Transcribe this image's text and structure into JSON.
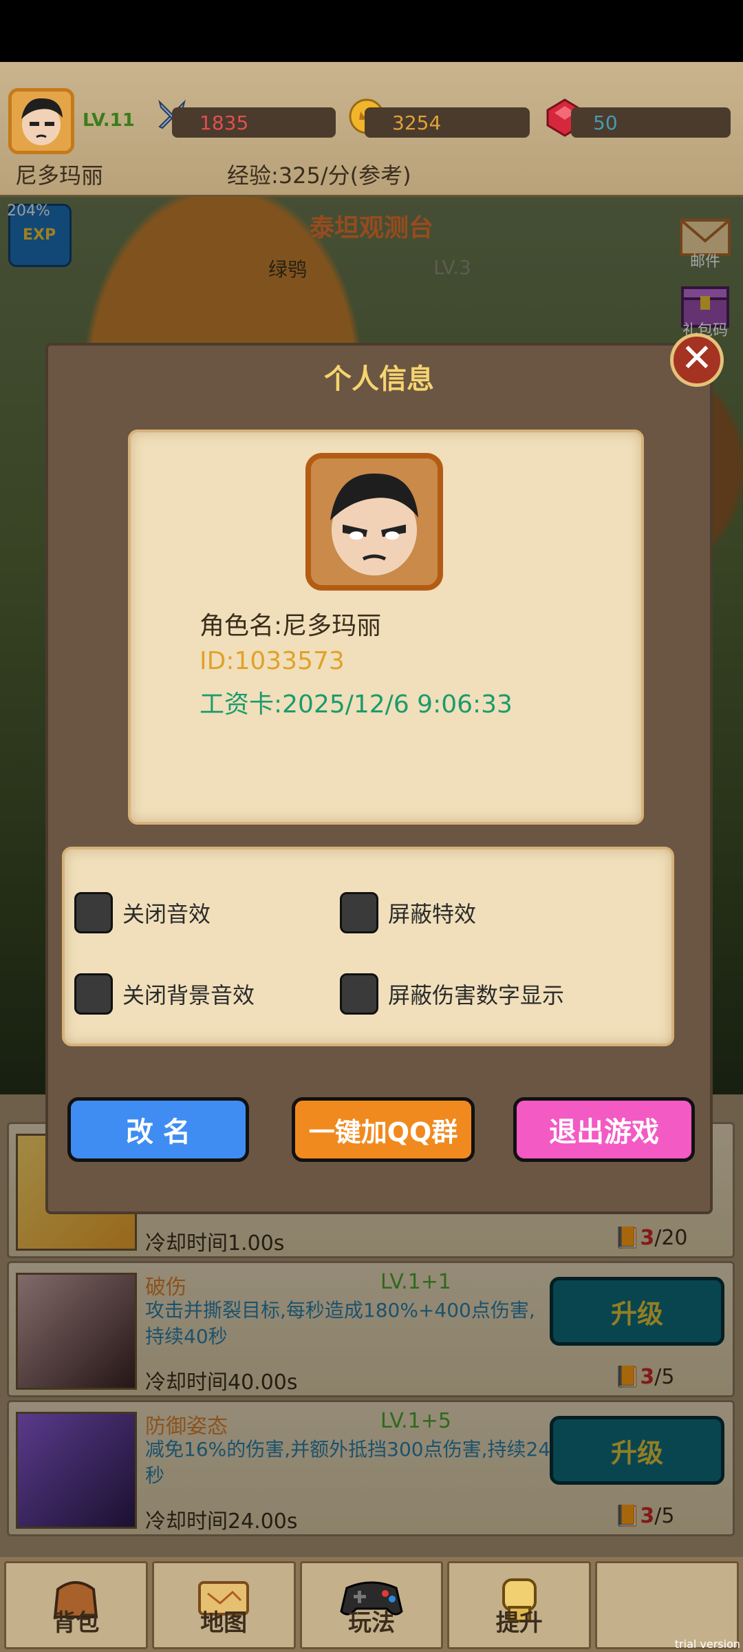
{
  "header": {
    "level": "LV.11",
    "power": "1835",
    "coins": "3254",
    "gems": "50",
    "username": "尼多玛丽",
    "exp_rate": "经验:325/分(参考)"
  },
  "scene": {
    "title": "泰坦观测台",
    "subtitle": "绿鸮",
    "level": "LV.3",
    "boost_percent": "204%",
    "boost_label": "EXP",
    "side_buttons": [
      "邮件",
      "礼包码"
    ]
  },
  "dialog": {
    "title": "个人信息",
    "close": "✕",
    "name_line": "角色名:尼多玛丽",
    "id_line": "ID:1033573",
    "pay_line": "工资卡:2025/12/6 9:06:33",
    "options": [
      "关闭音效",
      "屏蔽特效",
      "关闭背景音效",
      "屏蔽伤害数字显示"
    ],
    "buttons": {
      "rename": "改 名",
      "qq": "一键加QQ群",
      "quit": "退出游戏"
    }
  },
  "skills": [
    {
      "name": "",
      "level": "",
      "desc": "",
      "cooldown": "冷却时间1.00s",
      "cost_have": "3",
      "cost_total": "/20",
      "upgrade": ""
    },
    {
      "name": "破伤",
      "level": "LV.1+1",
      "desc": "攻击并撕裂目标,每秒造成180%+400点伤害,持续40秒",
      "cooldown": "冷却时间40.00s",
      "cost_have": "3",
      "cost_total": "/5",
      "upgrade": "升级"
    },
    {
      "name": "防御姿态",
      "level": "LV.1+5",
      "desc": "减免16%的伤害,并额外抵挡300点伤害,持续24秒",
      "cooldown": "冷却时间24.00s",
      "cost_have": "3",
      "cost_total": "/5",
      "upgrade": "升级"
    }
  ],
  "bottom_nav": [
    "背包",
    "地图",
    "玩法",
    "提升",
    ""
  ],
  "watermark": "trial version"
}
